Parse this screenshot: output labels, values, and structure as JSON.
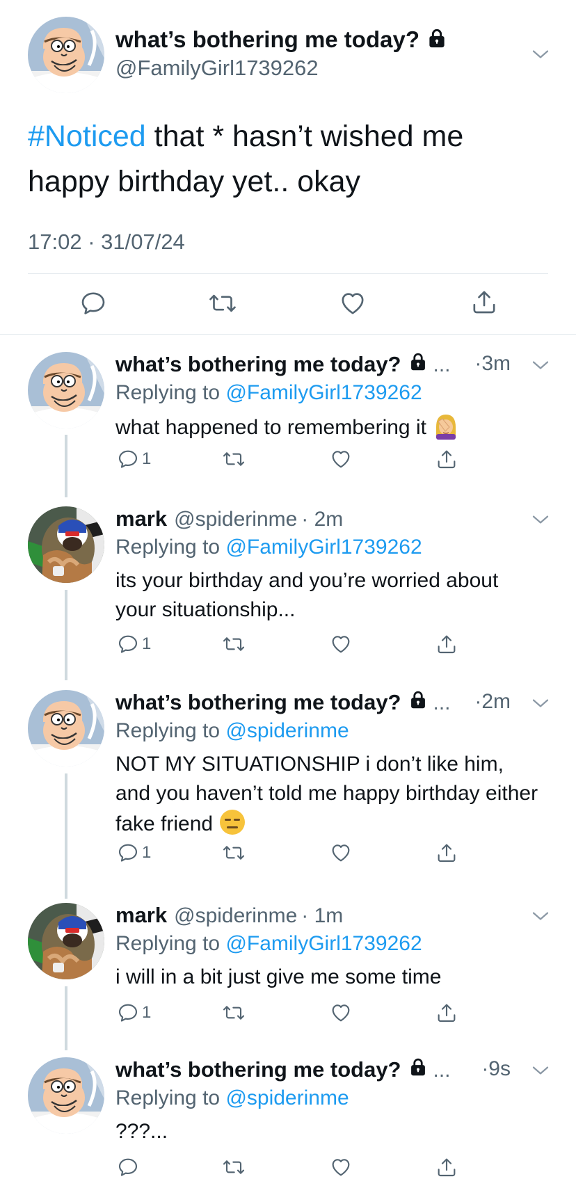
{
  "main_tweet": {
    "name": "what’s bothering me today?",
    "handle": "@FamilyGirl1739262",
    "hashtag": "#Noticed",
    "text": " that * hasn’t wished me happy birthday yet.. okay",
    "timestamp": "17:02 · 31/07/24"
  },
  "replies": [
    {
      "name": "what’s bothering me today?",
      "ellipsis": "...",
      "time": "·3m",
      "replying_prefix": "Replying to ",
      "replying_to": "@FamilyGirl1739262",
      "text": "what happened to remembering it",
      "emoji": "woman-facepalming",
      "reply_count": "1"
    },
    {
      "name": "mark",
      "handle": "@spiderinme",
      "time": "· 2m",
      "replying_prefix": "Replying to ",
      "replying_to": "@FamilyGirl1739262",
      "text": "its your birthday and you’re worried about your situationship...",
      "reply_count": "1"
    },
    {
      "name": "what’s bothering me today?",
      "ellipsis": "...",
      "time": "·2m",
      "replying_prefix": "Replying to ",
      "replying_to": "@spiderinme",
      "text": "NOT MY SITUATIONSHIP i don’t like him, and you haven’t told me happy birthday either fake friend",
      "emoji": "expressionless-face",
      "reply_count": "1"
    },
    {
      "name": "mark",
      "handle": "@spiderinme",
      "time": "· 1m",
      "replying_prefix": "Replying to ",
      "replying_to": "@FamilyGirl1739262",
      "text": "i will in a bit just give me some time",
      "reply_count": "1"
    },
    {
      "name": "what’s bothering me today?",
      "ellipsis": "...",
      "time": "·9s",
      "replying_prefix": "Replying to ",
      "replying_to": "@spiderinme",
      "text": "???...",
      "reply_count": ""
    }
  ],
  "colors": {
    "link": "#1d9bf0",
    "secondary_text": "#536471",
    "thread_line": "#cfd9de",
    "divider": "#e1e8ed"
  },
  "icons": [
    "reply-icon",
    "retweet-icon",
    "like-icon",
    "share-icon",
    "chevron-down-icon",
    "lock-icon"
  ]
}
